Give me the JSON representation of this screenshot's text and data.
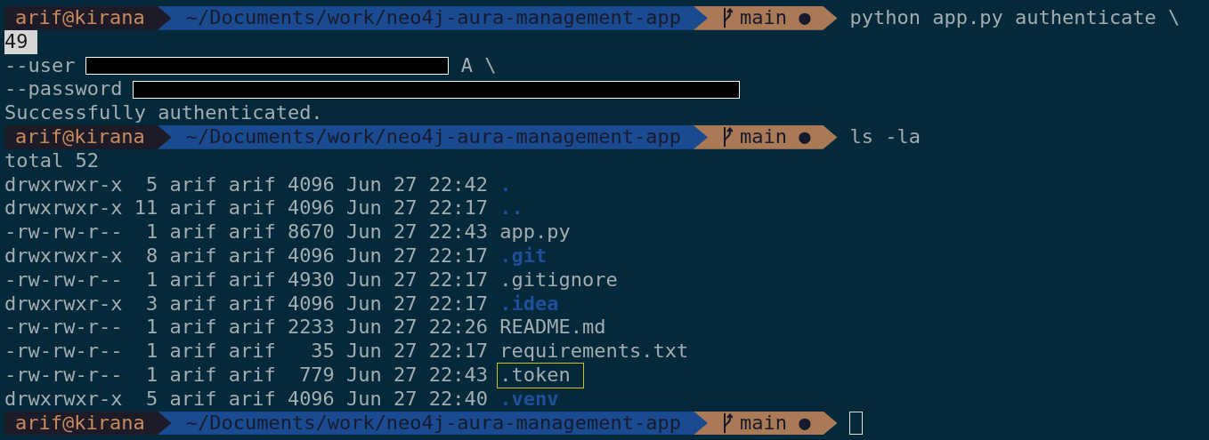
{
  "lines": [
    {
      "kind": "prompt",
      "user": "arif@kirana",
      "path": "~/Documents/work/neo4j-aura-management-app",
      "branch": "main",
      "status_mark": "●",
      "command": "python app.py authenticate \\"
    },
    {
      "kind": "selected",
      "text": "49"
    },
    {
      "kind": "redacted",
      "text": "--user",
      "tail": "A \\"
    },
    {
      "kind": "redacted",
      "text": "--password"
    },
    {
      "kind": "output",
      "text": "Successfully authenticated."
    },
    {
      "kind": "prompt",
      "user": "arif@kirana",
      "path": "~/Documents/work/neo4j-aura-management-app",
      "branch": "main",
      "status_mark": "●",
      "command": "ls -la"
    },
    {
      "kind": "output",
      "text": "total 52"
    },
    {
      "kind": "entry",
      "meta": "drwxrwxr-x  5 arif arif 4096 Jun 27 22:42",
      "name": ".",
      "dir": true,
      "highlighted": false
    },
    {
      "kind": "entry",
      "meta": "drwxrwxr-x 11 arif arif 4096 Jun 27 22:17",
      "name": "..",
      "dir": true,
      "highlighted": false
    },
    {
      "kind": "entry",
      "meta": "-rw-rw-r--  1 arif arif 8670 Jun 27 22:43",
      "name": "app.py",
      "dir": false,
      "highlighted": false
    },
    {
      "kind": "entry",
      "meta": "drwxrwxr-x  8 arif arif 4096 Jun 27 22:17",
      "name": ".git",
      "dir": true,
      "highlighted": false
    },
    {
      "kind": "entry",
      "meta": "-rw-rw-r--  1 arif arif 4930 Jun 27 22:17",
      "name": ".gitignore",
      "dir": false,
      "highlighted": false
    },
    {
      "kind": "entry",
      "meta": "drwxrwxr-x  3 arif arif 4096 Jun 27 22:17",
      "name": ".idea",
      "dir": true,
      "highlighted": false
    },
    {
      "kind": "entry",
      "meta": "-rw-rw-r--  1 arif arif 2233 Jun 27 22:26",
      "name": "README.md",
      "dir": false,
      "highlighted": false
    },
    {
      "kind": "entry",
      "meta": "-rw-rw-r--  1 arif arif   35 Jun 27 22:17",
      "name": "requirements.txt",
      "dir": false,
      "highlighted": false
    },
    {
      "kind": "entry",
      "meta": "-rw-rw-r--  1 arif arif  779 Jun 27 22:43",
      "name": ".token",
      "dir": false,
      "highlighted": true
    },
    {
      "kind": "entry",
      "meta": "drwxrwxr-x  5 arif arif 4096 Jun 27 22:40",
      "name": ".venv",
      "dir": true,
      "highlighted": false
    },
    {
      "kind": "prompt",
      "user": "arif@kirana",
      "path": "~/Documents/work/neo4j-aura-management-app",
      "branch": "main",
      "status_mark": "●",
      "cursor": true
    }
  ]
}
